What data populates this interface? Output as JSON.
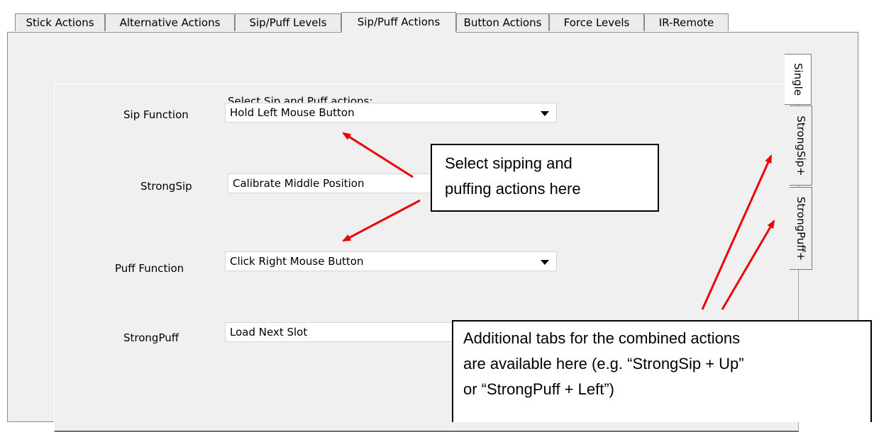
{
  "tabs": [
    {
      "label": "Stick Actions",
      "active": false
    },
    {
      "label": "Alternative Actions",
      "active": false
    },
    {
      "label": "Sip/Puff Levels",
      "active": false
    },
    {
      "label": "Sip/Puff Actions",
      "active": true
    },
    {
      "label": "Button Actions",
      "active": false
    },
    {
      "label": "Force Levels",
      "active": false
    },
    {
      "label": "IR-Remote",
      "active": false
    }
  ],
  "panel": {
    "heading": "Select Sip and Puff actions:",
    "rows": [
      {
        "label": "Sip Function",
        "value": "Hold Left Mouse Button"
      },
      {
        "label": "StrongSip",
        "value": "Calibrate Middle Position"
      },
      {
        "label": "Puff Function",
        "value": "Click Right Mouse Button"
      },
      {
        "label": "StrongPuff",
        "value": "Load Next Slot"
      }
    ]
  },
  "side_tabs": [
    {
      "label": "Single",
      "active": true
    },
    {
      "label": "StrongSip+",
      "active": false
    },
    {
      "label": "StrongPuff+",
      "active": false
    }
  ],
  "callouts": {
    "select": {
      "line1": "Select sipping and",
      "line2": "puffing actions here"
    },
    "additional": {
      "line1": "Additional tabs for the combined actions",
      "line2": "are available here (e.g. “StrongSip + Up”",
      "line3": "or “StrongPuff + Left”)"
    }
  },
  "colors": {
    "arrow": "#ee0000",
    "tab_bg": "#ececec",
    "panel_bg": "#f0f0f0"
  }
}
